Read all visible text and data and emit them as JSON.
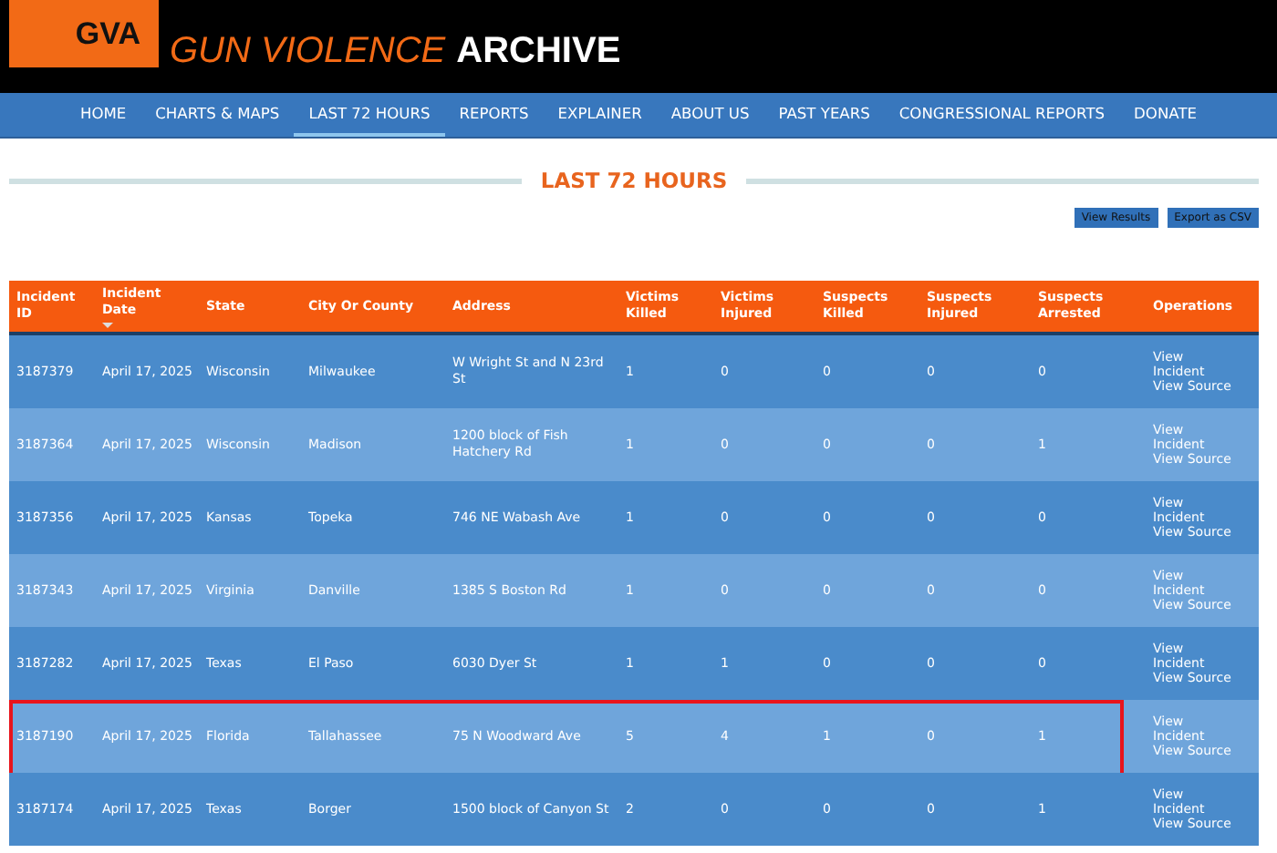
{
  "logo": {
    "badge": "GVA",
    "title_part1": "GUN VIOLENCE",
    "title_part2": "ARCHIVE"
  },
  "nav": [
    {
      "label": "HOME",
      "selected": false
    },
    {
      "label": "CHARTS & MAPS",
      "selected": false
    },
    {
      "label": "LAST 72 HOURS",
      "selected": true
    },
    {
      "label": "REPORTS",
      "selected": false
    },
    {
      "label": "EXPLAINER",
      "selected": false
    },
    {
      "label": "ABOUT US",
      "selected": false
    },
    {
      "label": "PAST YEARS",
      "selected": false
    },
    {
      "label": "CONGRESSIONAL REPORTS",
      "selected": false
    },
    {
      "label": "DONATE",
      "selected": false
    }
  ],
  "page_title": "LAST 72 HOURS",
  "buttons": [
    "View Results",
    "Export as CSV"
  ],
  "table": {
    "columns": [
      {
        "label": "Incident ID",
        "sorted": false
      },
      {
        "label": "Incident Date",
        "sorted": true
      },
      {
        "label": "State",
        "sorted": false
      },
      {
        "label": "City Or County",
        "sorted": false
      },
      {
        "label": "Address",
        "sorted": false
      },
      {
        "label": "Victims Killed",
        "sorted": false
      },
      {
        "label": "Victims Injured",
        "sorted": false
      },
      {
        "label": "Suspects Killed",
        "sorted": false
      },
      {
        "label": "Suspects Injured",
        "sorted": false
      },
      {
        "label": "Suspects Arrested",
        "sorted": false
      },
      {
        "label": "Operations",
        "sorted": false
      }
    ],
    "rows": [
      {
        "cells": [
          "3187379",
          "April 17, 2025",
          "Wisconsin",
          "Milwaukee",
          "W Wright St and N 23rd St",
          "1",
          "0",
          "0",
          "0",
          "0"
        ],
        "operations": [
          "View Incident",
          "View Source"
        ],
        "highlighted": false
      },
      {
        "cells": [
          "3187364",
          "April 17, 2025",
          "Wisconsin",
          "Madison",
          "1200 block of Fish Hatchery Rd",
          "1",
          "0",
          "0",
          "0",
          "1"
        ],
        "operations": [
          "View Incident",
          "View Source"
        ],
        "highlighted": false
      },
      {
        "cells": [
          "3187356",
          "April 17, 2025",
          "Kansas",
          "Topeka",
          "746 NE Wabash Ave",
          "1",
          "0",
          "0",
          "0",
          "0"
        ],
        "operations": [
          "View Incident",
          "View Source"
        ],
        "highlighted": false
      },
      {
        "cells": [
          "3187343",
          "April 17, 2025",
          "Virginia",
          "Danville",
          "1385 S Boston Rd",
          "1",
          "0",
          "0",
          "0",
          "0"
        ],
        "operations": [
          "View Incident",
          "View Source"
        ],
        "highlighted": false
      },
      {
        "cells": [
          "3187282",
          "April 17, 2025",
          "Texas",
          "El Paso",
          "6030 Dyer St",
          "1",
          "1",
          "0",
          "0",
          "0"
        ],
        "operations": [
          "View Incident",
          "View Source"
        ],
        "highlighted": false
      },
      {
        "cells": [
          "3187190",
          "April 17, 2025",
          "Florida",
          "Tallahassee",
          "75 N Woodward Ave",
          "5",
          "4",
          "1",
          "0",
          "1"
        ],
        "operations": [
          "View Incident",
          "View Source"
        ],
        "highlighted": true
      },
      {
        "cells": [
          "3187174",
          "April 17, 2025",
          "Texas",
          "Borger",
          "1500 block of Canyon St",
          "2",
          "0",
          "0",
          "0",
          "1"
        ],
        "operations": [
          "View Incident",
          "View Source"
        ],
        "highlighted": false
      }
    ]
  }
}
